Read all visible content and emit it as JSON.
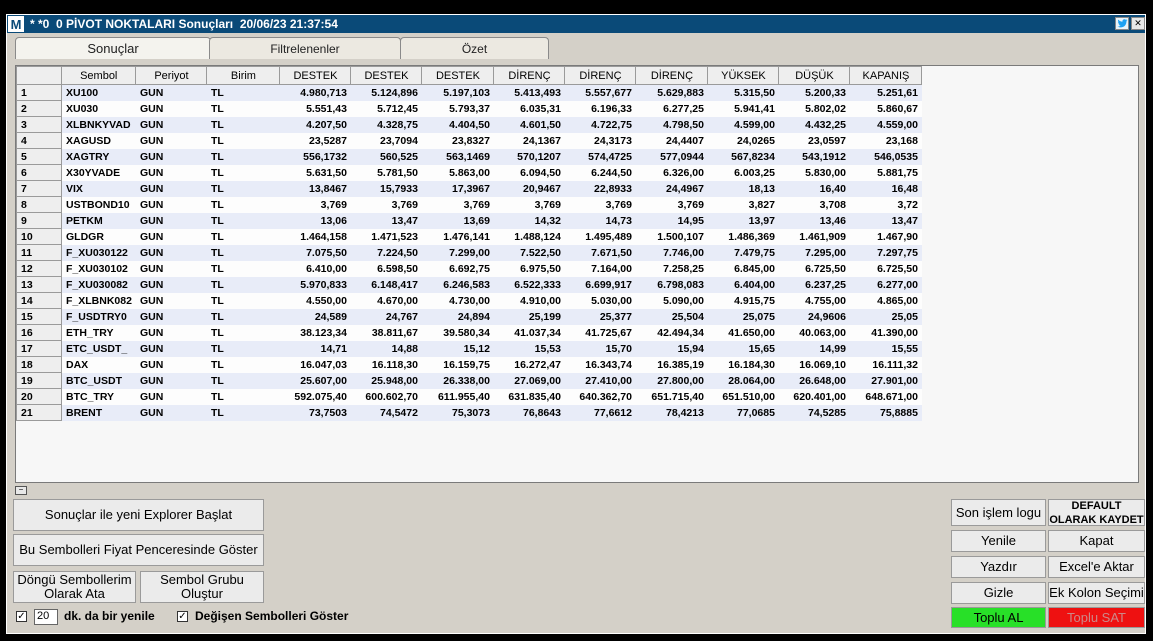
{
  "window": {
    "logo": "M",
    "title": "* *0  0 PİVOT NOKTALARI Sonuçları  20/06/23 21:37:54"
  },
  "tabs": [
    {
      "label": "Sonuçlar",
      "active": true
    },
    {
      "label": "Filtrelenenler",
      "active": false
    },
    {
      "label": "Özet",
      "active": false
    }
  ],
  "grid": {
    "columns": [
      "",
      "Sembol",
      "Periyot",
      "Birim",
      "DESTEK",
      "DESTEK",
      "DESTEK",
      "DİRENÇ",
      "DİRENÇ",
      "DİRENÇ",
      "YÜKSEK",
      "DÜŞÜK",
      "KAPANIŞ"
    ],
    "rows": [
      [
        "1",
        "XU100",
        "GUN",
        "TL",
        "4.980,713",
        "5.124,896",
        "5.197,103",
        "5.413,493",
        "5.557,677",
        "5.629,883",
        "5.315,50",
        "5.200,33",
        "5.251,61"
      ],
      [
        "2",
        "XU030",
        "GUN",
        "TL",
        "5.551,43",
        "5.712,45",
        "5.793,37",
        "6.035,31",
        "6.196,33",
        "6.277,25",
        "5.941,41",
        "5.802,02",
        "5.860,67"
      ],
      [
        "3",
        "XLBNKYVAD",
        "GUN",
        "TL",
        "4.207,50",
        "4.328,75",
        "4.404,50",
        "4.601,50",
        "4.722,75",
        "4.798,50",
        "4.599,00",
        "4.432,25",
        "4.559,00"
      ],
      [
        "4",
        "XAGUSD",
        "GUN",
        "TL",
        "23,5287",
        "23,7094",
        "23,8327",
        "24,1367",
        "24,3173",
        "24,4407",
        "24,0265",
        "23,0597",
        "23,168"
      ],
      [
        "5",
        "XAGTRY",
        "GUN",
        "TL",
        "556,1732",
        "560,525",
        "563,1469",
        "570,1207",
        "574,4725",
        "577,0944",
        "567,8234",
        "543,1912",
        "546,0535"
      ],
      [
        "6",
        "X30YVADE",
        "GUN",
        "TL",
        "5.631,50",
        "5.781,50",
        "5.863,00",
        "6.094,50",
        "6.244,50",
        "6.326,00",
        "6.003,25",
        "5.830,00",
        "5.881,75"
      ],
      [
        "7",
        "VIX",
        "GUN",
        "TL",
        "13,8467",
        "15,7933",
        "17,3967",
        "20,9467",
        "22,8933",
        "24,4967",
        "18,13",
        "16,40",
        "16,48"
      ],
      [
        "8",
        "USTBOND10",
        "GUN",
        "TL",
        "3,769",
        "3,769",
        "3,769",
        "3,769",
        "3,769",
        "3,769",
        "3,827",
        "3,708",
        "3,72"
      ],
      [
        "9",
        "PETKM",
        "GUN",
        "TL",
        "13,06",
        "13,47",
        "13,69",
        "14,32",
        "14,73",
        "14,95",
        "13,97",
        "13,46",
        "13,47"
      ],
      [
        "10",
        "GLDGR",
        "GUN",
        "TL",
        "1.464,158",
        "1.471,523",
        "1.476,141",
        "1.488,124",
        "1.495,489",
        "1.500,107",
        "1.486,369",
        "1.461,909",
        "1.467,90"
      ],
      [
        "11",
        "F_XU030122",
        "GUN",
        "TL",
        "7.075,50",
        "7.224,50",
        "7.299,00",
        "7.522,50",
        "7.671,50",
        "7.746,00",
        "7.479,75",
        "7.295,00",
        "7.297,75"
      ],
      [
        "12",
        "F_XU030102",
        "GUN",
        "TL",
        "6.410,00",
        "6.598,50",
        "6.692,75",
        "6.975,50",
        "7.164,00",
        "7.258,25",
        "6.845,00",
        "6.725,50",
        "6.725,50"
      ],
      [
        "13",
        "F_XU030082",
        "GUN",
        "TL",
        "5.970,833",
        "6.148,417",
        "6.246,583",
        "6.522,333",
        "6.699,917",
        "6.798,083",
        "6.404,00",
        "6.237,25",
        "6.277,00"
      ],
      [
        "14",
        "F_XLBNK082",
        "GUN",
        "TL",
        "4.550,00",
        "4.670,00",
        "4.730,00",
        "4.910,00",
        "5.030,00",
        "5.090,00",
        "4.915,75",
        "4.755,00",
        "4.865,00"
      ],
      [
        "15",
        "F_USDTRY0",
        "GUN",
        "TL",
        "24,589",
        "24,767",
        "24,894",
        "25,199",
        "25,377",
        "25,504",
        "25,075",
        "24,9606",
        "25,05"
      ],
      [
        "16",
        "ETH_TRY",
        "GUN",
        "TL",
        "38.123,34",
        "38.811,67",
        "39.580,34",
        "41.037,34",
        "41.725,67",
        "42.494,34",
        "41.650,00",
        "40.063,00",
        "41.390,00"
      ],
      [
        "17",
        "ETC_USDT_",
        "GUN",
        "TL",
        "14,71",
        "14,88",
        "15,12",
        "15,53",
        "15,70",
        "15,94",
        "15,65",
        "14,99",
        "15,55"
      ],
      [
        "18",
        "DAX",
        "GUN",
        "TL",
        "16.047,03",
        "16.118,30",
        "16.159,75",
        "16.272,47",
        "16.343,74",
        "16.385,19",
        "16.184,30",
        "16.069,10",
        "16.111,32"
      ],
      [
        "19",
        "BTC_USDT",
        "GUN",
        "TL",
        "25.607,00",
        "25.948,00",
        "26.338,00",
        "27.069,00",
        "27.410,00",
        "27.800,00",
        "28.064,00",
        "26.648,00",
        "27.901,00"
      ],
      [
        "20",
        "BTC_TRY",
        "GUN",
        "TL",
        "592.075,40",
        "600.602,70",
        "611.955,40",
        "631.835,40",
        "640.362,70",
        "651.715,40",
        "651.510,00",
        "620.401,00",
        "648.671,00"
      ],
      [
        "21",
        "BRENT",
        "GUN",
        "TL",
        "73,7503",
        "74,5472",
        "75,3073",
        "76,8643",
        "77,6612",
        "78,4213",
        "77,0685",
        "74,5285",
        "75,8885"
      ]
    ]
  },
  "collapse_glyph": "−",
  "buttons": {
    "start_explorer": "Sonuçlar ile yeni Explorer Başlat",
    "show_in_price": "Bu Sembolleri Fiyat Penceresinde Göster",
    "cycle_symbols": "Döngü Sembollerim Olarak Ata",
    "create_group": "Sembol Grubu Oluştur",
    "last_log": "Son işlem logu",
    "save_default": "DEFAULT OLARAK KAYDET",
    "refresh": "Yenile",
    "close": "Kapat",
    "print": "Yazdır",
    "export_excel": "Excel'e Aktar",
    "hide": "Gizle",
    "extra_columns": "Ek Kolon Seçimi",
    "bulk_buy": "Toplu AL",
    "bulk_sell": "Toplu SAT"
  },
  "options": {
    "refresh_checked_mark": "✓",
    "refresh_minutes": "20",
    "refresh_label": "dk. da bir yenile",
    "show_changed_mark": "✓",
    "show_changed_label": "Değişen Sembolleri Göster"
  },
  "colors": {
    "titlebar": "#0a4a78",
    "bulk_buy": "#28e028",
    "bulk_sell": "#ee1111"
  }
}
